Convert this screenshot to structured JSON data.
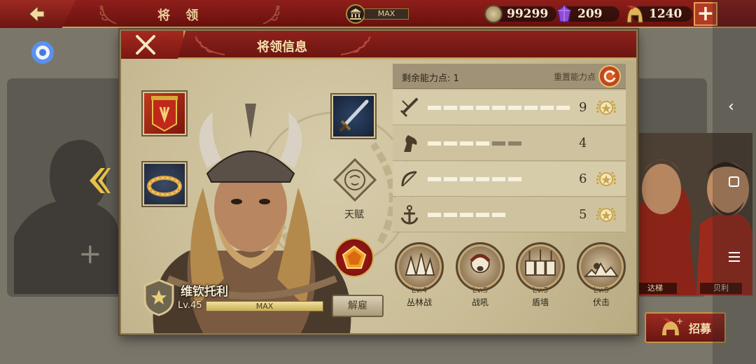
{
  "topbar": {
    "title": "将 领",
    "max_label": "MAX",
    "coins": "99299",
    "gems": "209",
    "helmets": "1240",
    "add_label": "+"
  },
  "dialog": {
    "title": "将领信息",
    "hero": {
      "name": "维钦托利",
      "level": "Lv.45",
      "exp_label": "MAX",
      "exp_fraction": 1.0
    },
    "talent_label": "天赋",
    "dismiss_label": "解雇",
    "points_label": "剩余能力点: 1",
    "reset_label": "重置能力点",
    "stats": [
      {
        "icon": "sword-icon",
        "value": "9",
        "filled": 9,
        "total": 9,
        "capped": true
      },
      {
        "icon": "horse-icon",
        "value": "4",
        "filled": 4,
        "total": 6,
        "capped": false
      },
      {
        "icon": "bow-icon",
        "value": "6",
        "filled": 6,
        "total": 6,
        "capped": true
      },
      {
        "icon": "anchor-icon",
        "value": "5",
        "filled": 5,
        "total": 5,
        "capped": true
      }
    ],
    "skills": [
      {
        "level": "Lv.4",
        "name": "丛林战",
        "icon": "forest-icon"
      },
      {
        "level": "Lv.5",
        "name": "战吼",
        "icon": "warcry-icon"
      },
      {
        "level": "Lv.3",
        "name": "盾墙",
        "icon": "shield-wall-icon"
      },
      {
        "level": "Lv.5",
        "name": "伏击",
        "icon": "ambush-icon"
      }
    ]
  },
  "background": {
    "name_left": "达梯",
    "name_right": "贝利",
    "recruit_label": "招募"
  },
  "colors": {
    "header_red": "#7e1915",
    "gold": "#c9a24a",
    "parchment": "#c6b992"
  }
}
